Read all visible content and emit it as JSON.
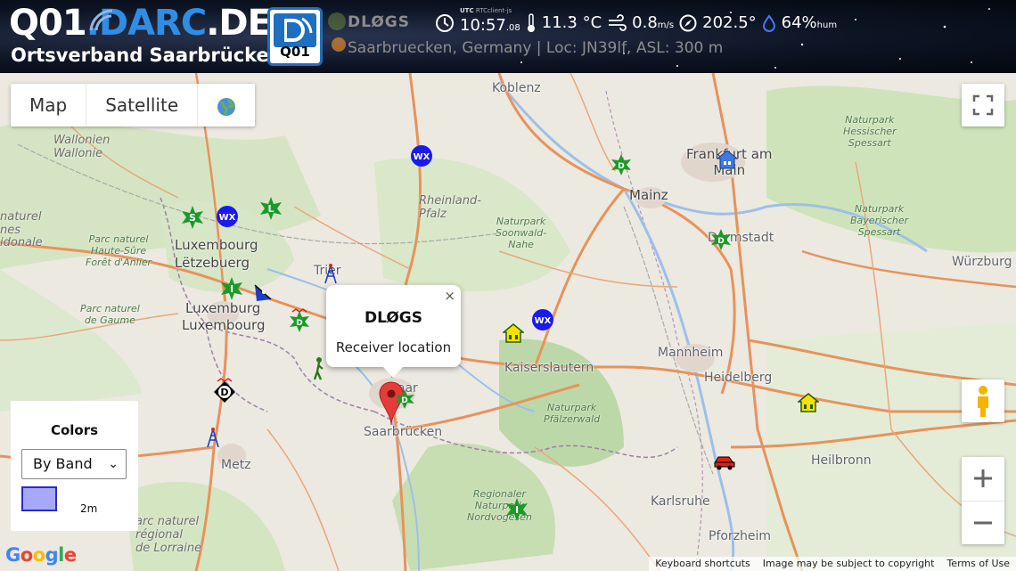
{
  "header": {
    "logo_prefix": "Q01",
    "logo_domain": ".DARC",
    "logo_tld": ".DE",
    "subtitle": "Ortsverband Saarbrücken",
    "tile_label": "Q01",
    "station": "DLØGS",
    "location": "Saarbruecken, Germany | Loc: JN39lf, ASL: 300 m",
    "utc_label": "UTC",
    "utc_note": "RTCclient-js",
    "time": "10:57",
    "seconds": ".08",
    "temperature": "11.3 °C",
    "wind_speed": "0.8",
    "wind_unit": "m/s",
    "wind_dir": "202.5°",
    "humidity": "64%",
    "humidity_unit": "hum"
  },
  "map": {
    "type_buttons": [
      "Map",
      "Satellite"
    ],
    "popup": {
      "title": "DLØGS",
      "text": "Receiver location",
      "close": "×"
    },
    "legend": {
      "title": "Colors",
      "select_value": "By Band",
      "band_label": "2m"
    },
    "footer": [
      "Keyboard shortcuts",
      "Image may be subject to copyright",
      "Terms of Use"
    ],
    "google": "Google",
    "labels": {
      "koblenz": "Koblenz",
      "wallonien": "Wallonien\nWallonie",
      "rheinland": "Rheinland-\nPfalz",
      "frankfurt": "Frankfurt am\nMain",
      "mainz": "Mainz",
      "darmstadt": "Darmstadt",
      "luxembourg1": "Luxembourg",
      "letzebuerg": "Lëtzebuerg",
      "luxembourg2": "Luxemburg",
      "luxembourg3": "Luxembourg",
      "trier": "Trier",
      "kaiserslautern": "Kaiserslautern",
      "saarbruecken": "Saarbrücken",
      "mannheim": "Mannheim",
      "heidelberg": "Heidelberg",
      "heilbronn": "Heilbronn",
      "karlsruhe": "Karlsruhe",
      "pforzheim": "Pforzheim",
      "wuerzburg": "Würzburg",
      "metz": "Metz",
      "naturel": "naturel\nnes",
      "idonale": "idonale",
      "saar": "Saar",
      "park_naturel": "Parc naturel\nHaute-Sûre\nForêt d'Anlier",
      "parc_gaume": "Parc naturel\nde Gaume",
      "park_soonwald": "Naturpark\nSoonwald-\nNahe",
      "park_pfaelzer": "Naturpark\nPfälzerwald",
      "park_hessisch": "Naturpark\nHessischer\nSpessart",
      "park_spessart": "Naturpark\nBayerischer\nSpessart",
      "park_nordvogesen": "Regionaler\nNaturpark\nNordvogesen",
      "parc_lorraine": "arc naturel\nrégional\nde Lorraine"
    }
  }
}
